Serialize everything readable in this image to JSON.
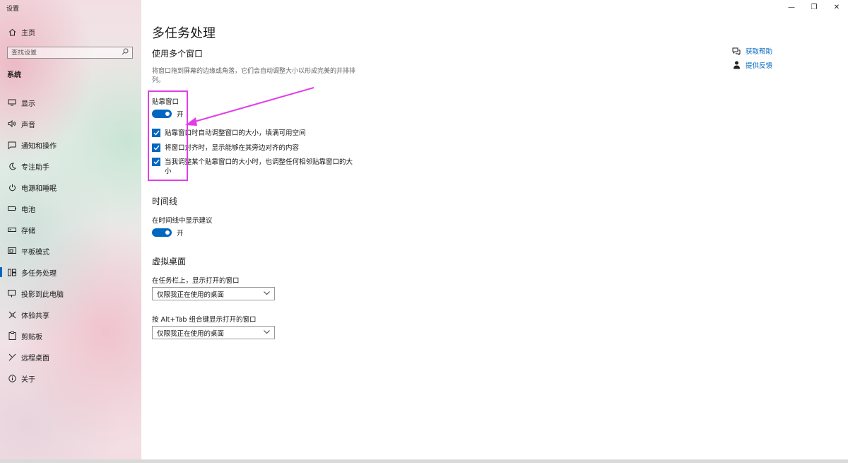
{
  "window": {
    "title": "设置",
    "controls": {
      "minimize": "—",
      "maximize": "❐",
      "close": "✕"
    }
  },
  "sidebar": {
    "home_label": "主页",
    "search_placeholder": "查找设置",
    "group_title": "系统",
    "items": [
      {
        "label": "显示",
        "icon": "monitor-icon"
      },
      {
        "label": "声音",
        "icon": "speaker-icon"
      },
      {
        "label": "通知和操作",
        "icon": "notification-icon"
      },
      {
        "label": "专注助手",
        "icon": "moon-icon"
      },
      {
        "label": "电源和睡眠",
        "icon": "power-icon"
      },
      {
        "label": "电池",
        "icon": "battery-icon"
      },
      {
        "label": "存储",
        "icon": "storage-icon"
      },
      {
        "label": "平板模式",
        "icon": "tablet-icon"
      },
      {
        "label": "多任务处理",
        "icon": "multitask-icon",
        "active": true
      },
      {
        "label": "投影到此电脑",
        "icon": "projector-icon"
      },
      {
        "label": "体验共享",
        "icon": "share-icon"
      },
      {
        "label": "剪贴板",
        "icon": "clipboard-icon"
      },
      {
        "label": "远程桌面",
        "icon": "remote-icon"
      },
      {
        "label": "关于",
        "icon": "info-icon"
      }
    ]
  },
  "main": {
    "title": "多任务处理",
    "snap": {
      "section_title": "使用多个窗口",
      "description": "将窗口拖到屏幕的边缘或角落，它们会自动调整大小以形成完美的并排排列。",
      "toggle_label": "贴靠窗口",
      "toggle_state": "开",
      "checkboxes": [
        {
          "label": "贴靠窗口时自动调整窗口的大小，填满可用空间",
          "checked": true
        },
        {
          "label": "将窗口对齐时，显示能够在其旁边对齐的内容",
          "checked": true
        },
        {
          "label": "当我调整某个贴靠窗口的大小时，也调整任何相邻贴靠窗口的大小",
          "checked": true
        }
      ]
    },
    "timeline": {
      "section_title": "时间线",
      "toggle_label": "在时间线中显示建议",
      "toggle_state": "开"
    },
    "virtual_desktops": {
      "section_title": "虚拟桌面",
      "taskbar_label": "在任务栏上，显示打开的窗口",
      "taskbar_value": "仅限我正在使用的桌面",
      "alttab_label": "按 Alt+Tab 组合键显示打开的窗口",
      "alttab_value": "仅限我正在使用的桌面"
    },
    "help_links": {
      "get_help": "获取帮助",
      "feedback": "提供反馈"
    }
  },
  "colors": {
    "accent": "#0067c0",
    "annotation": "#e23ee8"
  }
}
